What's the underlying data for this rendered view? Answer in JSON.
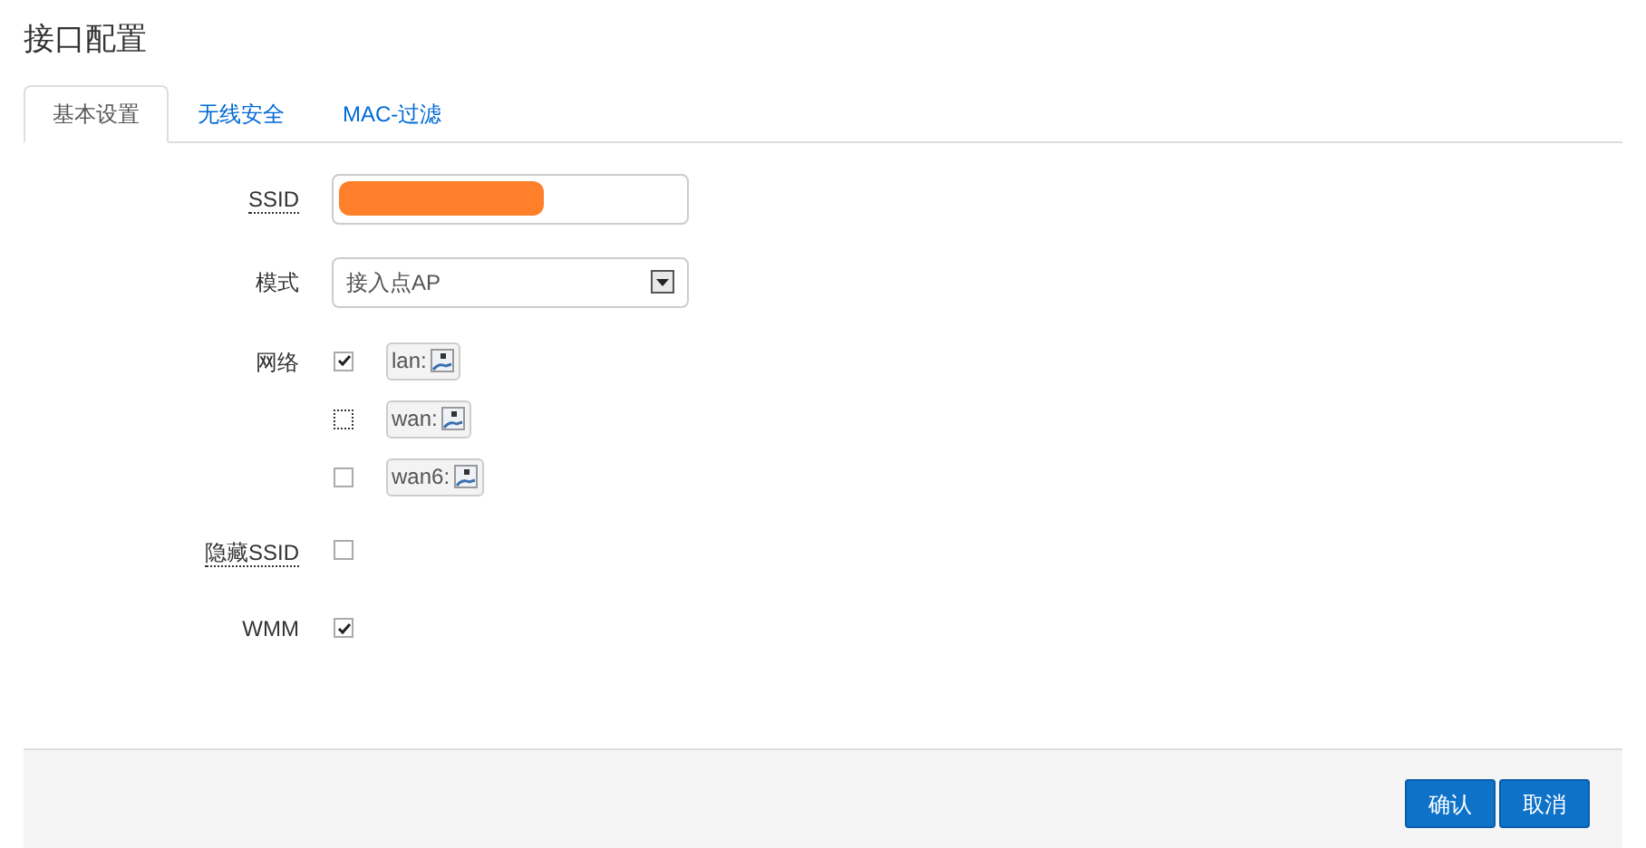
{
  "title": "接口配置",
  "tabs": [
    {
      "label": "基本设置",
      "selected": true
    },
    {
      "label": "无线安全",
      "selected": false
    },
    {
      "label": "MAC-过滤",
      "selected": false
    }
  ],
  "ssid": {
    "label": "SSID",
    "redacted": true
  },
  "mode": {
    "label": "模式",
    "value": "接入点AP"
  },
  "network": {
    "label": "网络",
    "options": [
      {
        "label": "lan:",
        "checked": true,
        "focused": false
      },
      {
        "label": "wan:",
        "checked": false,
        "focused": true
      },
      {
        "label": "wan6:",
        "checked": false,
        "focused": false
      }
    ]
  },
  "hide_ssid": {
    "label": "隐藏SSID",
    "checked": false
  },
  "wmm": {
    "label": "WMM",
    "checked": true
  },
  "buttons": [
    "确认",
    "取消"
  ]
}
